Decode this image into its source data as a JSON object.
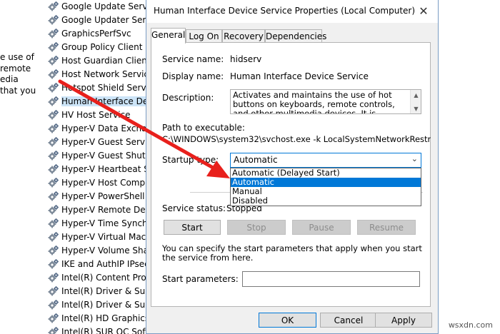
{
  "left_fragment": [
    "e use of",
    "remote",
    "edia",
    " that you"
  ],
  "services": [
    {
      "name": "Google Update Service",
      "selected": false
    },
    {
      "name": "Google Updater Service",
      "selected": false
    },
    {
      "name": "GraphicsPerfSvc",
      "selected": false
    },
    {
      "name": "Group Policy Client",
      "selected": false
    },
    {
      "name": "Host Guardian Client S",
      "selected": false
    },
    {
      "name": "Host Network Service",
      "selected": false
    },
    {
      "name": "Hotspot Shield Service",
      "selected": false
    },
    {
      "name": "Human Interface Devic",
      "selected": true
    },
    {
      "name": "HV Host Service",
      "selected": false
    },
    {
      "name": "Hyper-V Data Exchang",
      "selected": false
    },
    {
      "name": "Hyper-V Guest Service",
      "selected": false
    },
    {
      "name": "Hyper-V Guest Shutdo",
      "selected": false
    },
    {
      "name": "Hyper-V Heartbeat Ser",
      "selected": false
    },
    {
      "name": "Hyper-V Host Comput",
      "selected": false
    },
    {
      "name": "Hyper-V PowerShell Di",
      "selected": false
    },
    {
      "name": "Hyper-V Remote Deskt",
      "selected": false
    },
    {
      "name": "Hyper-V Time Synchro",
      "selected": false
    },
    {
      "name": "Hyper-V Virtual Machin",
      "selected": false
    },
    {
      "name": "Hyper-V Volume Shado",
      "selected": false
    },
    {
      "name": "IKE and AuthIP IPsec K",
      "selected": false
    },
    {
      "name": "Intel(R) Content Protec",
      "selected": false
    },
    {
      "name": "Intel(R) Driver & Suppo",
      "selected": false
    },
    {
      "name": "Intel(R) Driver & Suppo",
      "selected": false
    },
    {
      "name": "Intel(R) HD Graphics C",
      "selected": false
    },
    {
      "name": "Intel(R) SUR QC Softwa",
      "selected": false
    }
  ],
  "dialog": {
    "title": "Human Interface Device Service Properties (Local Computer)",
    "close_glyph": "✕",
    "tabs": [
      "General",
      "Log On",
      "Recovery",
      "Dependencies"
    ],
    "service_name_label": "Service name:",
    "service_name_value": "hidserv",
    "display_name_label": "Display name:",
    "display_name_value": "Human Interface Device Service",
    "description_label": "Description:",
    "description_value": "Activates and maintains the use of hot buttons on keyboards, remote controls, and other multimedia devices. It is recommended that you keep this",
    "path_label": "Path to executable:",
    "path_value": "C:\\WINDOWS\\system32\\svchost.exe -k LocalSystemNetworkRestricted -p",
    "startup_label": "Startup type:",
    "startup_value": "Automatic",
    "startup_options": [
      {
        "label": "Automatic (Delayed Start)",
        "highlighted": false
      },
      {
        "label": "Automatic",
        "highlighted": true
      },
      {
        "label": "Manual",
        "highlighted": false
      },
      {
        "label": "Disabled",
        "highlighted": false
      }
    ],
    "status_label": "Service status:",
    "status_value": "Stopped",
    "buttons": {
      "start": "Start",
      "stop": "Stop",
      "pause": "Pause",
      "resume": "Resume"
    },
    "params_help": "You can specify the start parameters that apply when you start the service from here.",
    "params_label": "Start parameters:",
    "params_value": "",
    "ok": "OK",
    "cancel": "Cancel",
    "apply": "Apply"
  },
  "watermark": "wsxdn.com",
  "colors": {
    "annotation_arrow": "#e8201c",
    "accent": "#0078d7",
    "selection": "#cce4f7"
  },
  "icons": {
    "service": "gear-icon",
    "close": "close-icon",
    "dropdown": "chevron-down-icon",
    "scroll_up": "scroll-up-icon",
    "scroll_down": "scroll-down-icon"
  }
}
